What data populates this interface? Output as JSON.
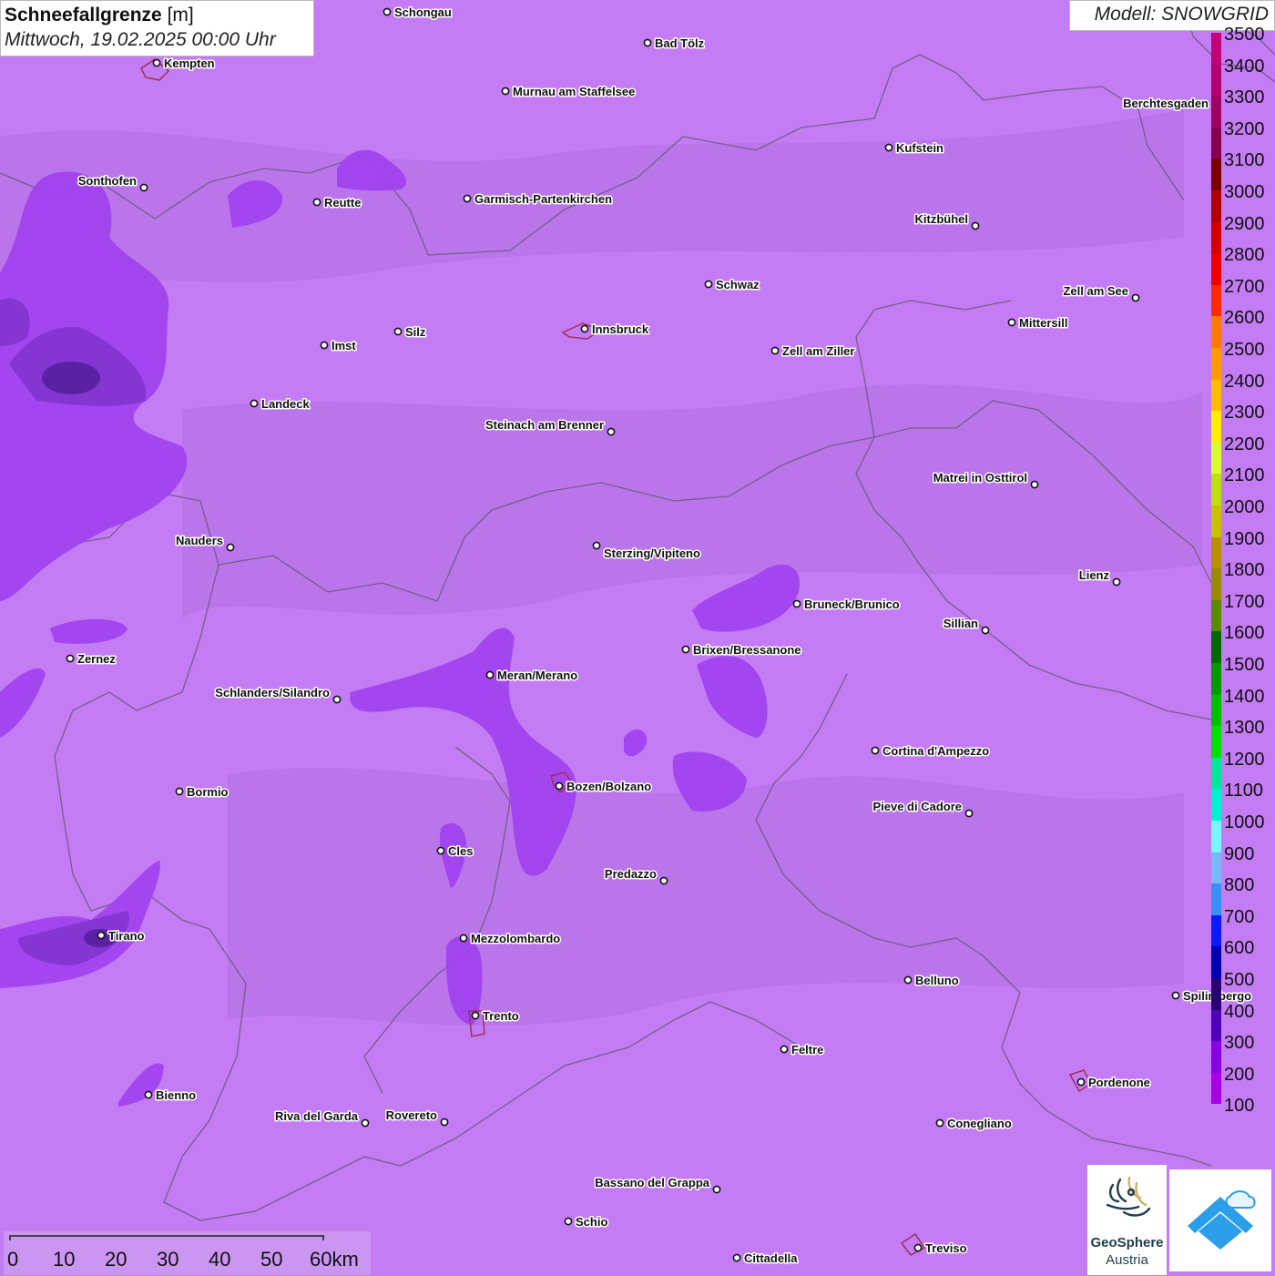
{
  "header": {
    "title_bold": "Schneefallgrenze",
    "title_unit": " [m]",
    "datetime": "Mittwoch, 19.02.2025 00:00 Uhr",
    "model": "Modell: SNOWGRID"
  },
  "legend": {
    "levels": [
      {
        "label": "3500",
        "color": "#c2007a"
      },
      {
        "label": "3400",
        "color": "#b30070"
      },
      {
        "label": "3300",
        "color": "#a10063"
      },
      {
        "label": "3200",
        "color": "#8a0050"
      },
      {
        "label": "3100",
        "color": "#7a0000"
      },
      {
        "label": "3000",
        "color": "#b00000"
      },
      {
        "label": "2900",
        "color": "#d40000"
      },
      {
        "label": "2800",
        "color": "#ee0000"
      },
      {
        "label": "2700",
        "color": "#ff2a00"
      },
      {
        "label": "2600",
        "color": "#ff7a00"
      },
      {
        "label": "2500",
        "color": "#ff9a00"
      },
      {
        "label": "2400",
        "color": "#ffbb00"
      },
      {
        "label": "2300",
        "color": "#ffee00"
      },
      {
        "label": "2200",
        "color": "#d9ff33"
      },
      {
        "label": "2100",
        "color": "#bde014"
      },
      {
        "label": "2000",
        "color": "#c8c000"
      },
      {
        "label": "1900",
        "color": "#b89000"
      },
      {
        "label": "1800",
        "color": "#998a00"
      },
      {
        "label": "1700",
        "color": "#5a8a00"
      },
      {
        "label": "1600",
        "color": "#006a00"
      },
      {
        "label": "1500",
        "color": "#009a00"
      },
      {
        "label": "1400",
        "color": "#00c000"
      },
      {
        "label": "1300",
        "color": "#00e000"
      },
      {
        "label": "1200",
        "color": "#00e69a"
      },
      {
        "label": "1100",
        "color": "#00f0d0"
      },
      {
        "label": "1000",
        "color": "#7af5ff"
      },
      {
        "label": "900",
        "color": "#7ab8f5"
      },
      {
        "label": "800",
        "color": "#3a8ff5"
      },
      {
        "label": "700",
        "color": "#0a1aff"
      },
      {
        "label": "600",
        "color": "#0000b0"
      },
      {
        "label": "500",
        "color": "#2a0070"
      },
      {
        "label": "400",
        "color": "#5000b8"
      },
      {
        "label": "300",
        "color": "#8a00e6"
      },
      {
        "label": "200",
        "color": "#a800e6"
      },
      {
        "label": "100",
        "color": "#c47cf4"
      }
    ]
  },
  "cities": [
    {
      "name": "Schongau"
    },
    {
      "name": "Bad Tölz"
    },
    {
      "name": "Kempten"
    },
    {
      "name": "Murnau am Staffelsee"
    },
    {
      "name": "Berchtesgaden"
    },
    {
      "name": "Kufstein"
    },
    {
      "name": "Sonthofen"
    },
    {
      "name": "Reutte"
    },
    {
      "name": "Garmisch-Partenkirchen"
    },
    {
      "name": "Kitzbühel"
    },
    {
      "name": "Schwaz"
    },
    {
      "name": "Zell am See"
    },
    {
      "name": "Innsbruck"
    },
    {
      "name": "Mittersill"
    },
    {
      "name": "Imst"
    },
    {
      "name": "Silz"
    },
    {
      "name": "Zell am Ziller"
    },
    {
      "name": "Landeck"
    },
    {
      "name": "Steinach am Brenner"
    },
    {
      "name": "Matrei in Osttirol"
    },
    {
      "name": "Nauders"
    },
    {
      "name": "Sterzing/Vipiteno"
    },
    {
      "name": "Lienz"
    },
    {
      "name": "Bruneck/Brunico"
    },
    {
      "name": "Sillian"
    },
    {
      "name": "Brixen/Bressanone"
    },
    {
      "name": "Zernez"
    },
    {
      "name": "Meran/Merano"
    },
    {
      "name": "Schlanders/Silandro"
    },
    {
      "name": "Cortina d'Ampezzo"
    },
    {
      "name": "Bozen/Bolzano"
    },
    {
      "name": "Bormio"
    },
    {
      "name": "Pieve di Cadore"
    },
    {
      "name": "Cles"
    },
    {
      "name": "Predazzo"
    },
    {
      "name": "Tirano"
    },
    {
      "name": "Mezzolombardo"
    },
    {
      "name": "Belluno"
    },
    {
      "name": "Spilimbergo"
    },
    {
      "name": "Trento"
    },
    {
      "name": "Feltre"
    },
    {
      "name": "Pordenone"
    },
    {
      "name": "Bienno"
    },
    {
      "name": "Riva del Garda"
    },
    {
      "name": "Rovereto"
    },
    {
      "name": "Conegliano"
    },
    {
      "name": "Bassano del Grappa"
    },
    {
      "name": "Schio"
    },
    {
      "name": "Treviso"
    },
    {
      "name": "Cittadella"
    }
  ],
  "scale": {
    "labels": [
      "0",
      "10",
      "20",
      "30",
      "40",
      "50",
      "60km"
    ]
  },
  "logo": {
    "line1": "GeoSphere",
    "line2": "Austria"
  }
}
